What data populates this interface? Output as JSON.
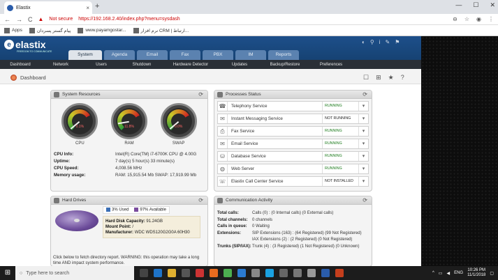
{
  "browser": {
    "tab_title": "Elastix",
    "tab_close": "×",
    "new_tab": "+",
    "win_controls": [
      "—",
      "☐",
      "✕"
    ],
    "back": "←",
    "forward": "→",
    "reload": "C",
    "not_secure": "Not secure",
    "url": "https://192.168.2.40/index.php?menu=sysdash",
    "right_icons": [
      "⊖",
      "☆",
      "◉",
      "⋮"
    ],
    "bookmarks": [
      "Apps",
      "پیام گستر پسردان",
      "www.payamgostar...",
      "نرم افزار CRM | ارتباط..."
    ]
  },
  "elastix": {
    "logo": "elastix",
    "logo_sub": "FREEDOM TO COMMUNICATE",
    "top_tools": [
      "◐",
      "⚲",
      "i",
      "✎",
      "⚑"
    ],
    "main_tabs": [
      "System",
      "Agenda",
      "Email",
      "Fax",
      "PBX",
      "IM",
      "Reports"
    ],
    "active_tab": "System",
    "subnav": [
      "Dashboard",
      "Network",
      "Users",
      "Shutdown",
      "Hardware Detector",
      "Updates",
      "Backup/Restore",
      "Preferences"
    ],
    "page_title": "Dashboard",
    "page_tools": [
      "☐",
      "⊞",
      "★",
      "?"
    ]
  },
  "system_resources": {
    "title": "System Resources",
    "gauges": [
      {
        "label": "CPU",
        "value": "0.1%",
        "pct": 0.1
      },
      {
        "label": "RAM",
        "value": "11.8%",
        "pct": 11.8
      },
      {
        "label": "SWAP",
        "value": "0.0%",
        "pct": 0.0
      }
    ],
    "info": [
      {
        "k": "CPU Info:",
        "v": "Intel(R) Core(TM) i7-6700K CPU @ 4.00G"
      },
      {
        "k": "Uptime:",
        "v": "7 day(s) 5 hour(s) 33 minute(s)"
      },
      {
        "k": "CPU Speed:",
        "v": "4,008.56 MHz"
      },
      {
        "k": "Memory usage:",
        "v": "RAM: 15,915.54 Mb SWAP: 17,919.99 Mb"
      }
    ]
  },
  "processes_status": {
    "title": "Processes Status",
    "services": [
      {
        "name": "Telephony Service",
        "status": "RUNNING",
        "icon": "☎"
      },
      {
        "name": "Instant Messaging Service",
        "status": "NOT RUNNING",
        "icon": "✉"
      },
      {
        "name": "Fax Service",
        "status": "RUNNING",
        "icon": "⎙"
      },
      {
        "name": "Email Service",
        "status": "RUNNING",
        "icon": "✉"
      },
      {
        "name": "Database Service",
        "status": "RUNNING",
        "icon": "⛁"
      },
      {
        "name": "Web Server",
        "status": "RUNNING",
        "icon": "◍"
      },
      {
        "name": "Elastix Call Center Service",
        "status": "NOT INSTALLED",
        "icon": "☏"
      }
    ]
  },
  "hard_drives": {
    "title": "Hard Drives",
    "used_label": "3% Used",
    "avail_label": "97% Available",
    "used_pct": 3,
    "used_color": "#3b6fb6",
    "avail_color": "#7a4c9e",
    "capacity_k": "Hard Disk Capacity:",
    "capacity_v": "91.24GB",
    "mount_k": "Mount Point:",
    "mount_v": "/",
    "manu_k": "Manufacturer:",
    "manu_v": "WDC WDS120G2G0A 60H30",
    "note": "Click below to fetch directory report. WARNING: this operation may take a long time AND impact system performance."
  },
  "communication": {
    "title": "Communication Activity",
    "rows": [
      {
        "k": "Total calls:",
        "v": "Calls (0) : (0 Internal calls) (0 External calls)"
      },
      {
        "k": "Total channels:",
        "v": "0 channels"
      },
      {
        "k": "Calls in queue:",
        "v": "0 Waiting"
      },
      {
        "k": "Extensions:",
        "v": "SIP Extensions (163) : (64 Registered) (99 Not Registered)"
      },
      {
        "k": "",
        "v": "IAX Extensions (2) : (2 Registered) (0 Not Registered)"
      },
      {
        "k": "Trunks (SIP/IAX):",
        "v": "Trunk (4) : (3 Registered) (1 Not Registered) (0 Unknown)"
      }
    ]
  },
  "taskbar": {
    "search": "Type here to search",
    "lang": "ENG",
    "time": "10:26 PM",
    "date": "11/1/2018"
  }
}
